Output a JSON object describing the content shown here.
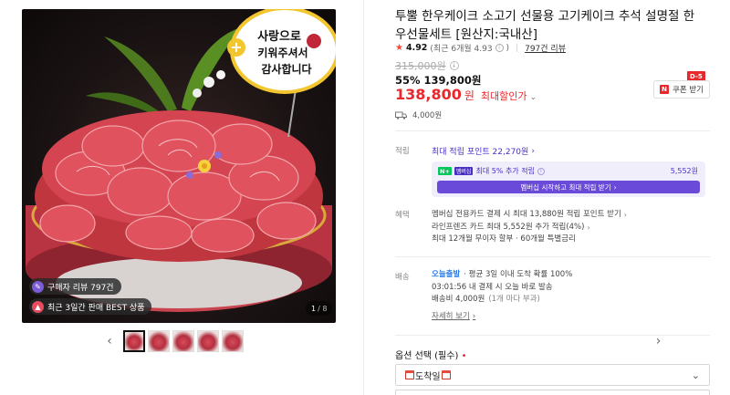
{
  "gallery": {
    "topper_text": [
      "사랑으로",
      "키워주셔서",
      "감사합니다"
    ],
    "badges": [
      {
        "icon": "review-icon",
        "label": "구매자 리뷰 797건"
      },
      {
        "icon": "fire-icon",
        "label": "최근 3일간 판매 BEST 상품"
      }
    ],
    "counter_current": "1",
    "counter_total": "/ 8",
    "thumb_count": 5
  },
  "product": {
    "title": "투뿔 한우케이크 소고기 선물용 고기케이크 추석 설명절 한우선물세트 [원산지:국내산]",
    "rating": {
      "star": "★",
      "score": "4.92",
      "recent": "(최근 6개월 4.93",
      "recent_close": ")",
      "reviews": "797건 리뷰"
    },
    "original_price": "315,000원",
    "discount_line": "55% 139,800원",
    "final_amount": "138,800",
    "final_unit": "원",
    "max_discount": "최대할인가",
    "coupon": {
      "label": "쿠폰 받기",
      "tag": "D-5",
      "logo": "N"
    },
    "shipping_fee": "4,000원"
  },
  "points": {
    "label": "적립",
    "max_points": "최대 적립 포인트 22,270원",
    "membership": {
      "nplus": "N+",
      "tag": "멤버십",
      "text": "최대 5% 추가 적립",
      "amount": "5,552원",
      "cta": "멤버십 시작하고 최대 적립 받기"
    }
  },
  "benefits": {
    "label": "혜택",
    "items": [
      "멤버십 전용카드 결제 시 최대 13,880원 적립 포인트 받기",
      "라인프렌즈 카드 최대 5,552원 추가 적립(4%)",
      "최대 12개월 무이자 할부 · 60개월 특별금리"
    ]
  },
  "delivery": {
    "label": "배송",
    "today_label": "오늘출발",
    "today_desc": "· 평균 3일 이내 도착 확률 100%",
    "cutoff": "03:01:56  내 결제 시 오늘 바로 발송",
    "fee": "배송비 4,000원",
    "fee_note": "(1개 마다 부과)",
    "more": "자세히 보기"
  },
  "option": {
    "label": "옵션 선택 (필수)",
    "required_mark": "•",
    "select_value": "도착일"
  }
}
